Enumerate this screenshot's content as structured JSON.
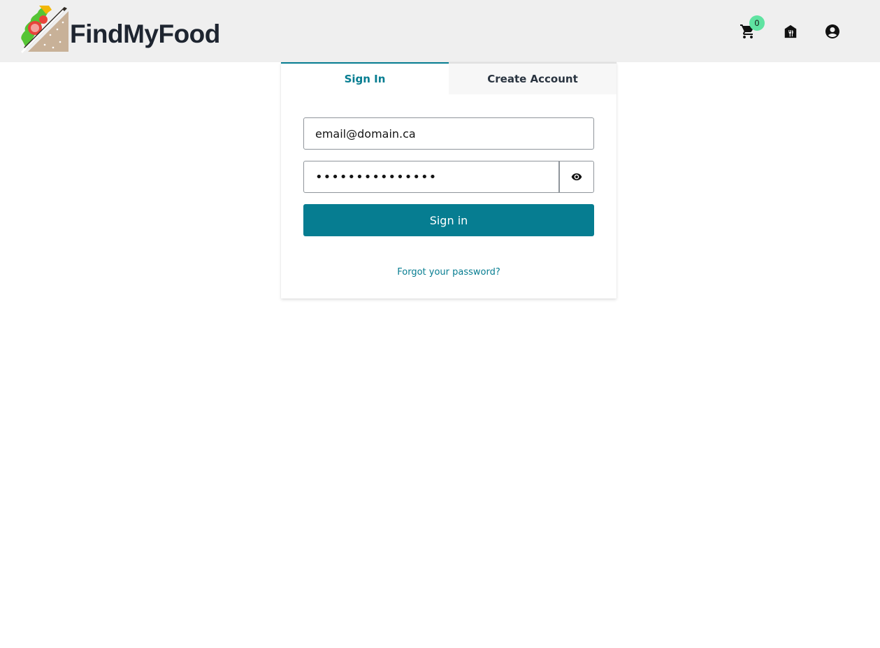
{
  "header": {
    "logo_text": "FindMyFood",
    "cart_count": "0",
    "icons": {
      "cart": "cart-icon",
      "restaurant": "restaurant-icon",
      "account": "account-icon"
    }
  },
  "auth": {
    "tabs": [
      {
        "label": "Sign In",
        "active": true
      },
      {
        "label": "Create Account",
        "active": false
      }
    ],
    "email": {
      "value": "email@domain.ca"
    },
    "password": {
      "value": "•••••••••••••••"
    },
    "toggle_icon": "eye-icon",
    "signin_label": "Sign in",
    "forgot_label": "Forgot your password?"
  },
  "colors": {
    "accent": "#067d91",
    "header_bg": "#efefef",
    "badge": "#5fe3a1",
    "text_dark": "#1e2530"
  }
}
